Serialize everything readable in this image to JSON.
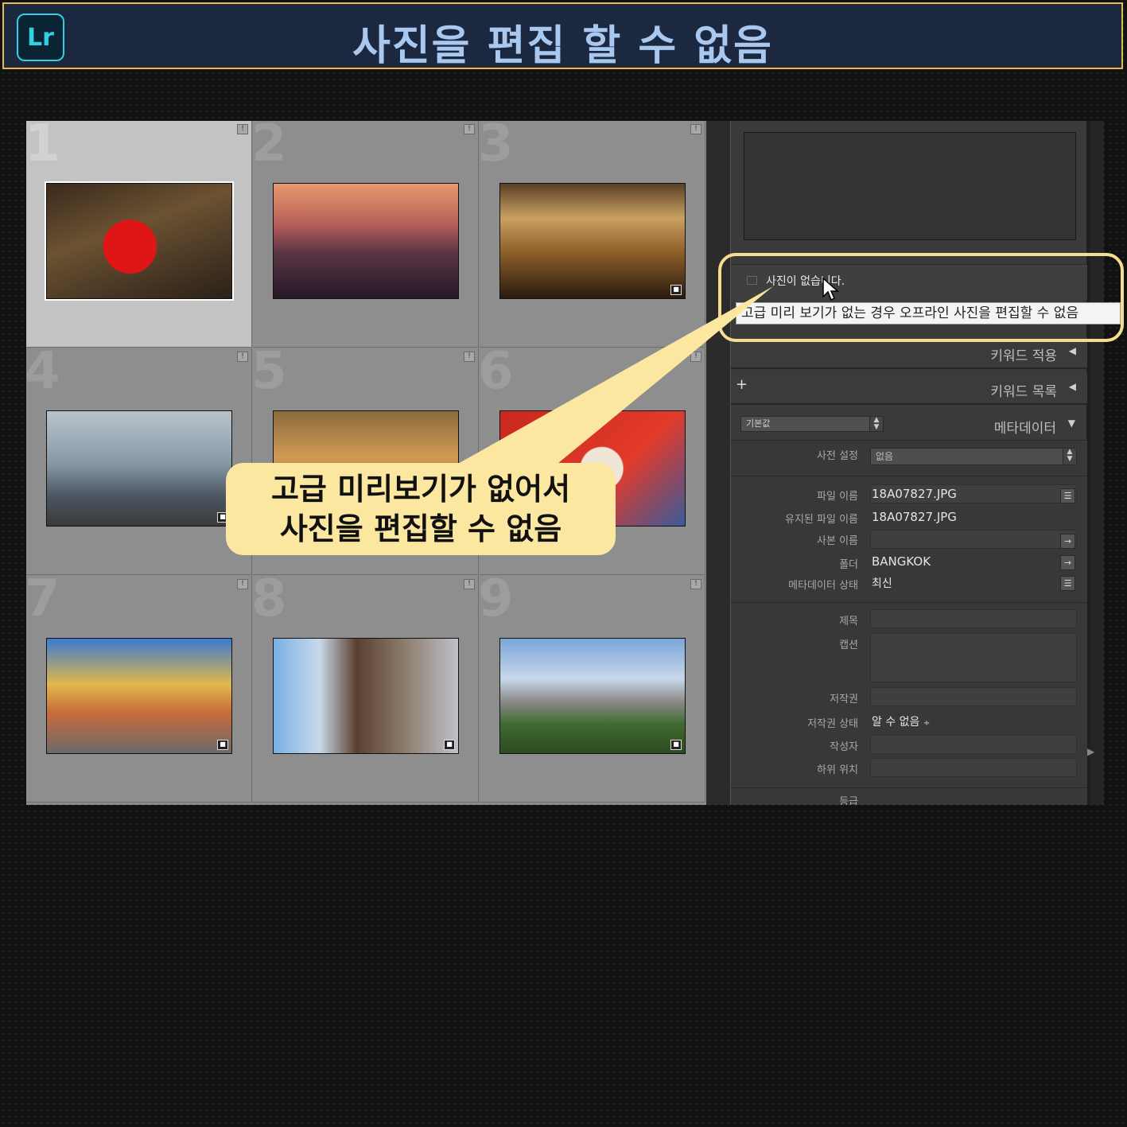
{
  "banner": {
    "logo_text": "Lr",
    "title": "사진을 편집 할 수 없음"
  },
  "grid": {
    "cells": [
      {
        "number": "1",
        "badge": "!",
        "selected": true
      },
      {
        "number": "2",
        "badge": "!"
      },
      {
        "number": "3",
        "badge": "!"
      },
      {
        "number": "4",
        "badge": "!"
      },
      {
        "number": "5",
        "badge": "!"
      },
      {
        "number": "6",
        "badge": "!"
      },
      {
        "number": "7",
        "badge": "!"
      },
      {
        "number": "8",
        "badge": "!"
      },
      {
        "number": "9",
        "badge": "!"
      }
    ]
  },
  "panel": {
    "no_photo_label": "사진이 없습니다.",
    "tooltip": "고급 미리 보기가 없는 경우 오프라인 사진을 편집할 수 없음",
    "keyword_apply": "키워드 적용",
    "keyword_list": "키워드 목록",
    "keyword_list_plus": "+",
    "preset_default": "기본값",
    "metadata_title": "메타데이터",
    "metadata": {
      "preset_label": "사전 설정",
      "preset_value": "없음",
      "filename_label": "파일 이름",
      "filename_value": "18A07827.JPG",
      "preserved_label": "유지된 파일 이름",
      "preserved_value": "18A07827.JPG",
      "copy_label": "사본 이름",
      "folder_label": "폴더",
      "folder_value": "BANGKOK",
      "status_label": "메타데이터 상태",
      "status_value": "최신",
      "title_label": "제목",
      "caption_label": "캡션",
      "copyright_label": "저작권",
      "copyright_status_label": "저작권 상태",
      "copyright_status_value": "알 수 없음",
      "creator_label": "작성자",
      "sublocation_label": "하위 위치",
      "rating_label": "등급"
    }
  },
  "callout": {
    "line1": "고급 미리보기가 없어서",
    "line2": "사진을 편집할 수 없음"
  },
  "colors": {
    "banner_bg": "#1c2740",
    "banner_border": "#e9b84a",
    "logo": "#31d1e3",
    "callout_bg": "#fbe7a0",
    "highlight": "#f5dc90"
  }
}
